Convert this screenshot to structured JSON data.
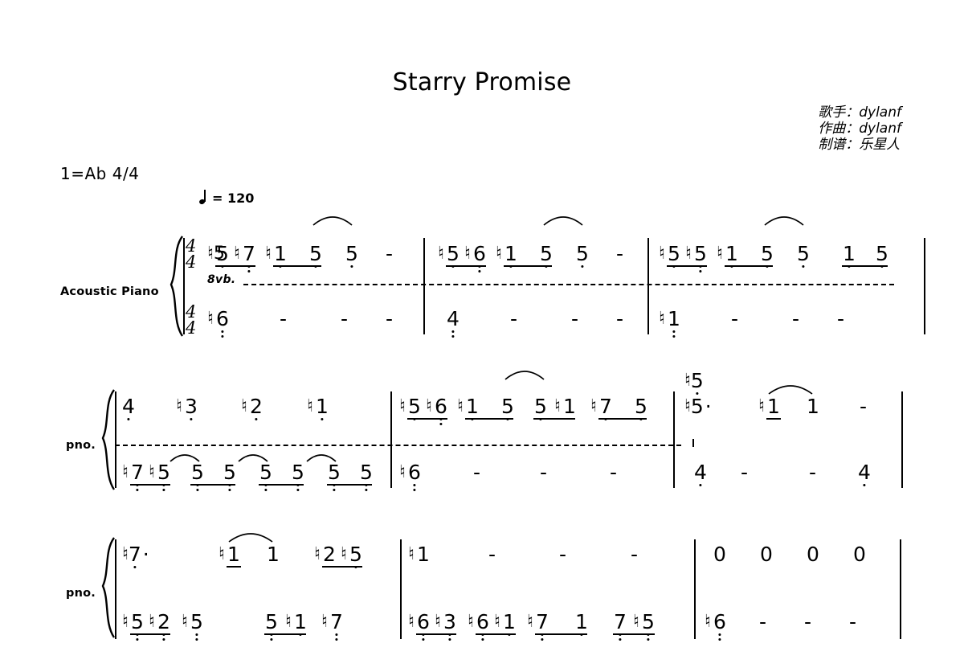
{
  "document": {
    "title": "Starry Promise",
    "key_signature": "1=Ab 4/4",
    "tempo_text": "= 120",
    "tempo_bpm": 120,
    "notation_type": "jianpu",
    "time_signature": {
      "top": "4",
      "bottom": "4"
    },
    "ottava_label": "8vb."
  },
  "credits": {
    "singer": "歌手：dylanf",
    "composer": "作曲：dylanf",
    "arranger": "制谱：乐星人"
  },
  "labels": {
    "instrument_full": "Acoustic Piano",
    "instrument_short_2": "pno.",
    "instrument_short_3": "pno."
  },
  "systems": [
    {
      "id": "system-1",
      "label": "Acoustic Piano",
      "treble": [
        {
          "measure": 1,
          "notes": [
            "♮5",
            "♮7",
            "♮1",
            "5",
            "5",
            "-"
          ]
        },
        {
          "measure": 2,
          "notes": [
            "♮5",
            "♮6",
            "♮1",
            "5",
            "5",
            "-"
          ]
        },
        {
          "measure": 3,
          "notes": [
            "♮5",
            "♮5",
            "♮1",
            "5",
            "5",
            "1",
            "5"
          ]
        }
      ],
      "bass": [
        {
          "measure": 1,
          "notes": [
            "♮6",
            "-",
            "-",
            "-"
          ]
        },
        {
          "measure": 2,
          "notes": [
            "4",
            "-",
            "-",
            "-"
          ]
        },
        {
          "measure": 3,
          "notes": [
            "♮1",
            "-",
            "-",
            "-"
          ]
        }
      ]
    },
    {
      "id": "system-2",
      "label": "pno.",
      "treble": [
        {
          "measure": 4,
          "notes": [
            "4",
            "♮3",
            "♮2",
            "♮1"
          ]
        },
        {
          "measure": 5,
          "notes": [
            "♮5",
            "♮6",
            "♮1",
            "5",
            "5",
            "♮1",
            "♮7",
            "5"
          ]
        },
        {
          "measure": 6,
          "notes": [
            "♮5",
            "♮5·",
            "♮1",
            "1",
            "-"
          ]
        }
      ],
      "bass": [
        {
          "measure": 4,
          "notes": [
            "♮7",
            "♮5",
            "5",
            "5",
            "5",
            "5",
            "5",
            "5"
          ]
        },
        {
          "measure": 5,
          "notes": [
            "♮6",
            "-",
            "-",
            "-"
          ]
        },
        {
          "measure": 6,
          "notes": [
            "4",
            "-",
            "-",
            "4"
          ]
        }
      ]
    },
    {
      "id": "system-3",
      "label": "pno.",
      "treble": [
        {
          "measure": 7,
          "notes": [
            "♮7·",
            "♮1",
            "1",
            "♮2",
            "♮5"
          ]
        },
        {
          "measure": 8,
          "notes": [
            "♮1",
            "-",
            "-",
            "-"
          ]
        },
        {
          "measure": 9,
          "notes": [
            "0",
            "0",
            "0",
            "0"
          ]
        }
      ],
      "bass": [
        {
          "measure": 7,
          "notes": [
            "♮5",
            "♮2",
            "♮5",
            "5",
            "♮1",
            "♮7"
          ]
        },
        {
          "measure": 8,
          "notes": [
            "♮6",
            "♮3",
            "♮6",
            "♮1",
            "♮7",
            "1",
            "7",
            "♮5"
          ]
        },
        {
          "measure": 9,
          "notes": [
            "♮6",
            "-",
            "-",
            "-"
          ]
        }
      ]
    }
  ],
  "glyphs": {
    "natural": "♮",
    "dash": "-",
    "rest": "0",
    "dot": "·"
  },
  "colors": {
    "ink": "#000000",
    "paper": "#ffffff"
  }
}
